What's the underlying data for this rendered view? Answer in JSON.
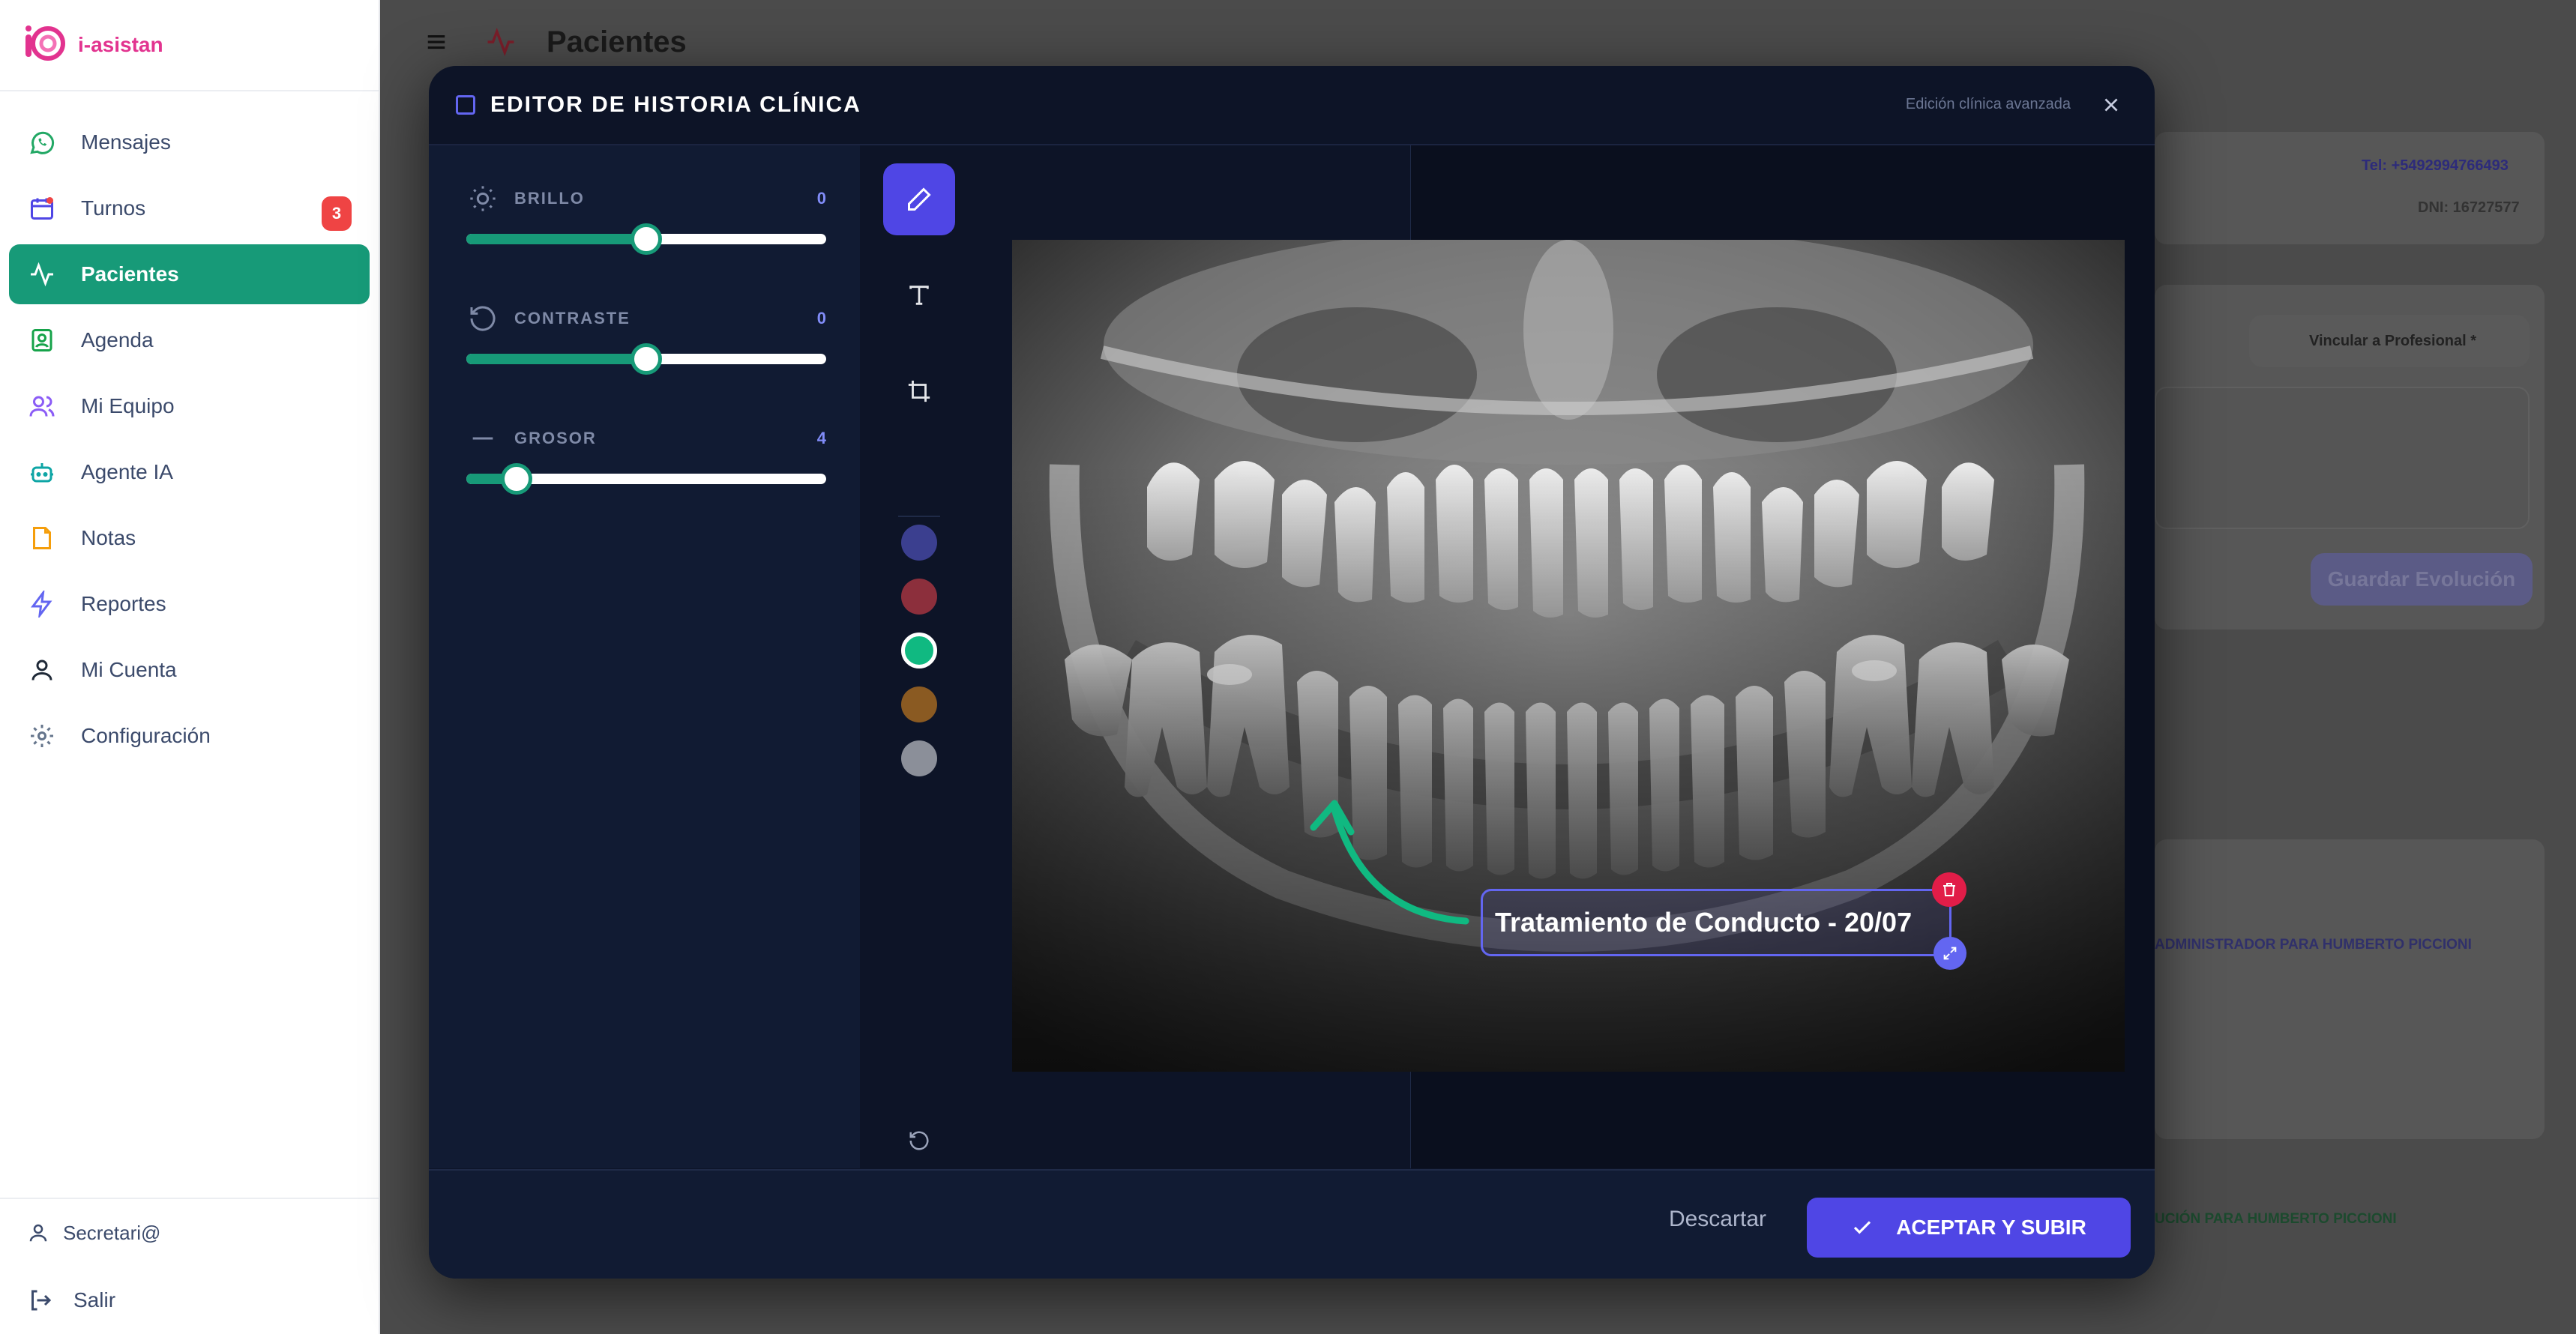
{
  "brand": {
    "name": "i-asistan"
  },
  "sidebar": {
    "items": [
      {
        "label": "Mensajes",
        "icon": "whatsapp-icon",
        "color": "#22a865"
      },
      {
        "label": "Turnos",
        "icon": "calendar-icon",
        "color": "#4f46e5",
        "badge": "3"
      },
      {
        "label": "Pacientes",
        "icon": "activity-icon",
        "color": "#ffffff",
        "active": true
      },
      {
        "label": "Agenda",
        "icon": "contact-book-icon",
        "color": "#16a34a"
      },
      {
        "label": "Mi Equipo",
        "icon": "users-icon",
        "color": "#8b5cf6"
      },
      {
        "label": "Agente IA",
        "icon": "bot-icon",
        "color": "#0ea5a5"
      },
      {
        "label": "Notas",
        "icon": "note-icon",
        "color": "#f59e0b"
      },
      {
        "label": "Reportes",
        "icon": "bolt-icon",
        "color": "#6366f1"
      },
      {
        "label": "Mi Cuenta",
        "icon": "user-icon",
        "color": "#1f2937"
      },
      {
        "label": "Configuración",
        "icon": "gear-icon",
        "color": "#64748b"
      }
    ],
    "user": "Secretari@",
    "logout": "Salir"
  },
  "page": {
    "title": "Pacientes",
    "tel": "Tel: +5492994766493",
    "dni": "DNI: 16727577",
    "link_prof": "Vincular a Profesional *",
    "save_evolution": "Guardar Evolución",
    "tag_admin": "ADMINISTRADOR PARA HUMBERTO PICCIONI",
    "tag_evolution": "UCIÓN PARA HUMBERTO PICCIONI"
  },
  "modal": {
    "title": "EDITOR DE HISTORIA CLÍNICA",
    "subtitle": "Edición clínica avanzada",
    "sliders": [
      {
        "label": "BRILLO",
        "value": "0",
        "fraction": 0.5,
        "icon": "sun-icon"
      },
      {
        "label": "CONTRASTE",
        "value": "0",
        "fraction": 0.5,
        "icon": "rotate-ccw-icon"
      },
      {
        "label": "GROSOR",
        "value": "4",
        "fraction": 0.14,
        "icon": "minus-icon"
      }
    ],
    "swatches": [
      "#3b3f8f",
      "#8c2f3c",
      "#10b981",
      "#8a5a22",
      "#8b8f99"
    ],
    "selected_swatch": 2,
    "annotation_text": "Tratamiento de Conducto - 20/07",
    "discard": "Descartar",
    "accept": "ACEPTAR Y SUBIR"
  }
}
